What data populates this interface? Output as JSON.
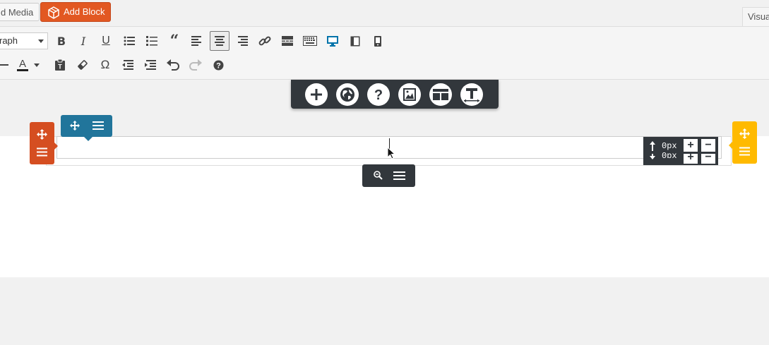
{
  "header": {
    "add_media_label": "d Media",
    "add_block_label": "Add Block",
    "visual_tab_label": "Visua"
  },
  "toolbar": {
    "format_select_value": "raph",
    "row1": [
      "bold-icon",
      "italic-icon",
      "underline-icon",
      "bullet-list-icon",
      "numbered-list-icon",
      "blockquote-icon",
      "align-left-icon",
      "align-center-icon",
      "align-right-icon",
      "link-icon",
      "read-more-icon",
      "keyboard-shortcuts-icon",
      "desktop-view-icon",
      "tablet-view-icon",
      "mobile-view-icon"
    ],
    "row2": [
      "horizontal-line-icon",
      "text-color-icon",
      "paste-as-text-icon",
      "clear-formatting-icon",
      "special-character-icon",
      "outdent-icon",
      "indent-icon",
      "undo-icon",
      "redo-icon",
      "help-icon"
    ],
    "bold_glyph": "B",
    "italic_glyph": "I",
    "underline_glyph": "U",
    "text_color_glyph": "A",
    "omega_glyph": "Ω"
  },
  "float_toolbar": {
    "buttons": [
      "add-icon",
      "globe-icon",
      "help-icon",
      "image-icon",
      "layout-icon",
      "text-icon"
    ]
  },
  "spacing": {
    "top_value": "0px",
    "bottom_value": "0px",
    "plus": "+",
    "minus": "−"
  },
  "colors": {
    "accent_orange": "#e25822",
    "row_handle": "#d54e21",
    "column_handle": "#21759b",
    "right_handle": "#ffba00",
    "dark_toolbar": "#32373c",
    "desktop_active": "#0073aa"
  }
}
